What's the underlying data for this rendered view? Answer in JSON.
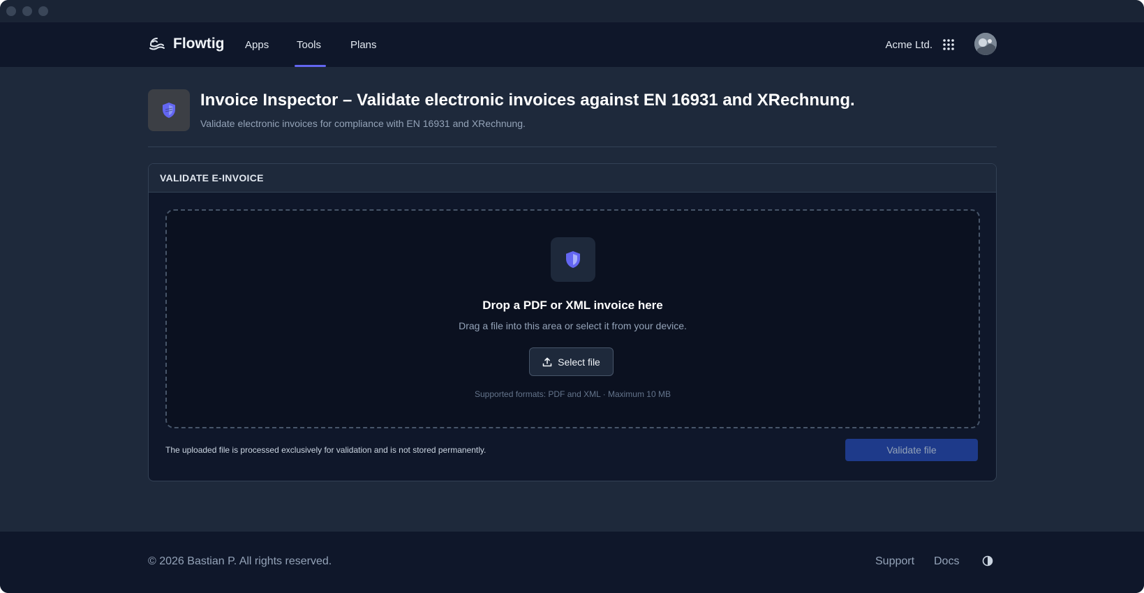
{
  "app": {
    "brand": "Flowtig",
    "org_name": "Acme Ltd."
  },
  "nav": {
    "items": [
      {
        "label": "Apps"
      },
      {
        "label": "Tools",
        "active": true
      },
      {
        "label": "Plans"
      }
    ]
  },
  "page": {
    "title": "Invoice Inspector – Validate electronic invoices against EN 16931 and XRechnung.",
    "subtitle": "Validate electronic invoices for compliance with EN 16931 and XRechnung."
  },
  "card": {
    "title": "VALIDATE E-INVOICE",
    "dropzone": {
      "title": "Drop a PDF or XML invoice here",
      "subtitle": "Drag a file into this area or select it from your device.",
      "select_label": "Select file",
      "formats": "Supported formats: PDF and XML · Maximum 10 MB"
    },
    "privacy_note": "The uploaded file is processed exclusively for validation and is not stored permanently.",
    "validate_label": "Validate file"
  },
  "footer": {
    "copyright": "© 2026 Bastian P. All rights reserved.",
    "links": [
      {
        "label": "Support"
      },
      {
        "label": "Docs"
      }
    ]
  },
  "icons": {
    "brand": "wave-logo-icon",
    "apps_grid": "grid-icon",
    "header": "shield-icon",
    "dropzone": "shield-icon",
    "upload": "upload-icon",
    "theme": "contrast-icon"
  },
  "colors": {
    "accent": "#6366f1",
    "primary_button": "#1e3a8a",
    "background": "#1e293b",
    "surface": "#0f172a"
  }
}
